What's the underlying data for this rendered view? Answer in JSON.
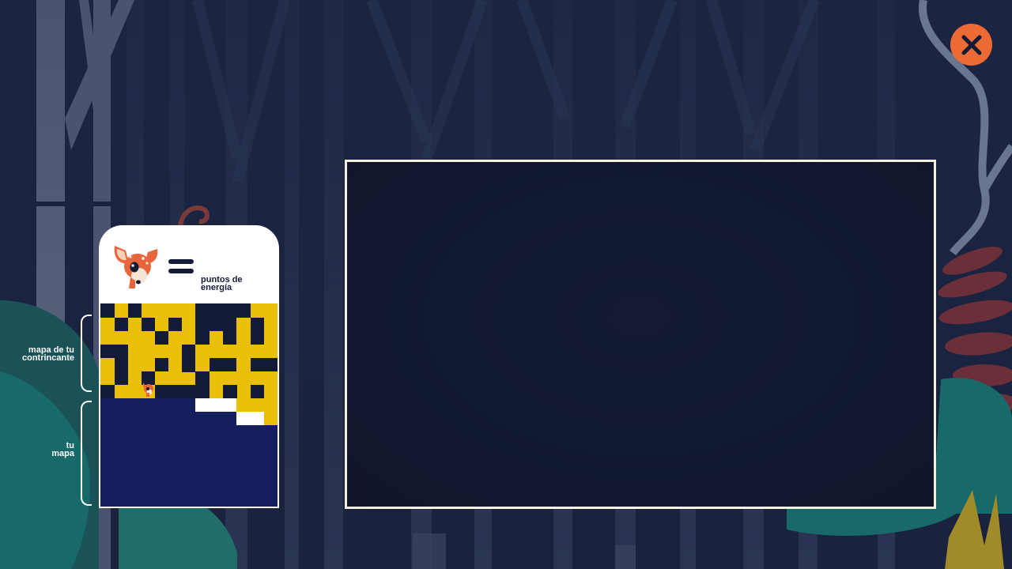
{
  "legend": {
    "energy_label": "puntos de\nenergía",
    "opponent_map_label": "mapa de tu\ncontrincante",
    "your_map_label": "tu\nmapa"
  },
  "colors": {
    "background": "#1a2440",
    "card": "#ffffff",
    "maze_yellow": "#e9bf08",
    "maze_dark": "#141b36",
    "own_map": "#151e5c",
    "close_button": "#ec6a34",
    "panel_border": "#f3f0de",
    "panel_bg": "#111832"
  },
  "icons": [
    "close-icon",
    "deer-icon",
    "equals-icon"
  ]
}
